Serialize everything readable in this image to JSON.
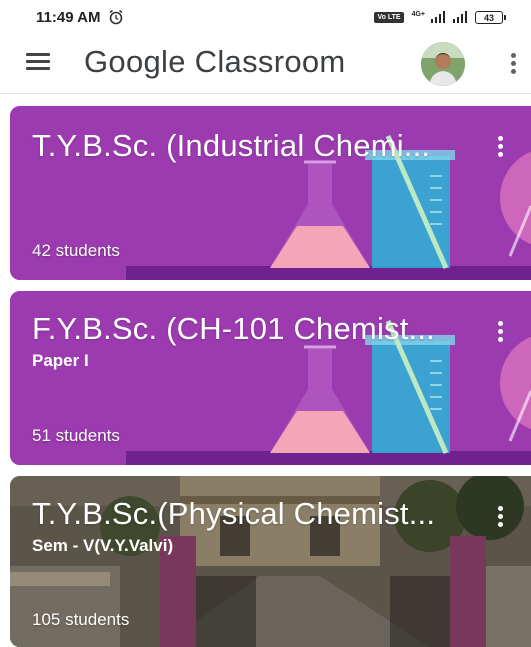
{
  "status_bar": {
    "time": "11:49 AM",
    "volte_label": "Vo LTE",
    "network_type": "4G+",
    "battery": "43"
  },
  "app_bar": {
    "title": "Google Classroom"
  },
  "classes": [
    {
      "title": "T.Y.B.Sc. (Industrial Chemi...",
      "subtitle": "",
      "students": "42 students"
    },
    {
      "title": "F.Y.B.Sc. (CH-101 Chemist...",
      "subtitle": "Paper I",
      "students": "51 students"
    },
    {
      "title": "T.Y.B.Sc.(Physical Chemist...",
      "subtitle": "Sem - V(V.Y.Valvi)",
      "students": "105 students"
    }
  ],
  "colors": {
    "card_purple": "#9c3bb0",
    "card_purple_dark": "#6f2190"
  },
  "icons": {
    "menu": "hamburger-menu-icon",
    "more": "more-vert-icon",
    "alarm": "alarm-clock-icon",
    "signal": "cell-signal-icon",
    "battery": "battery-icon"
  }
}
